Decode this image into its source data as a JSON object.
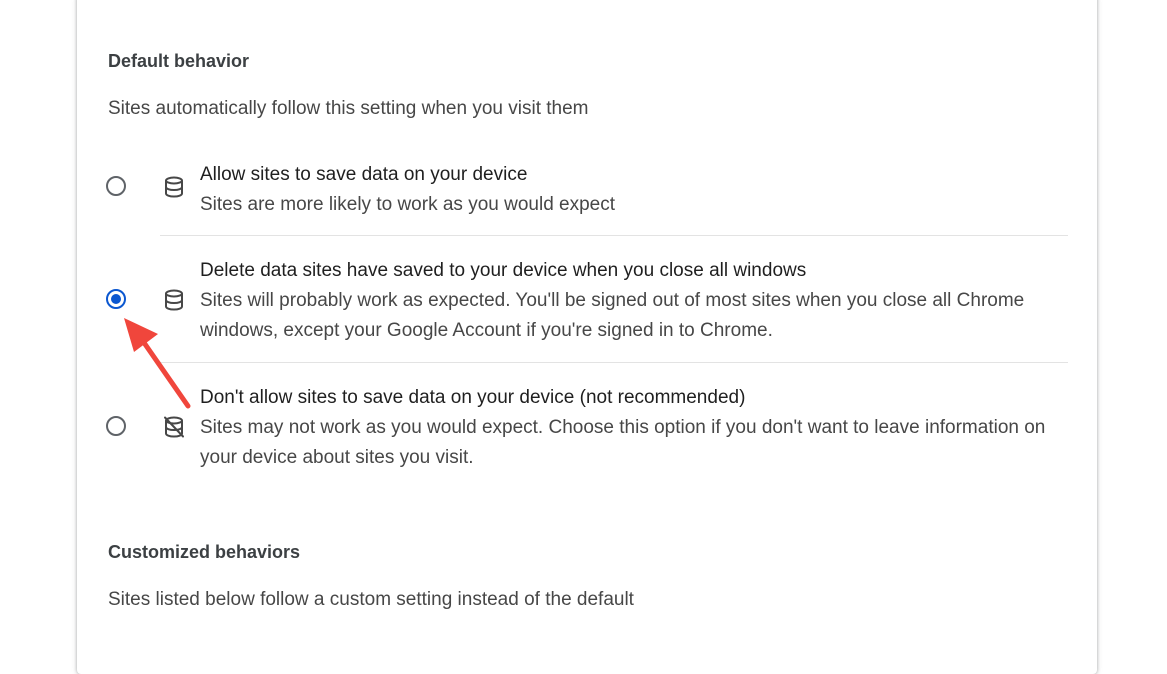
{
  "default_behavior": {
    "heading": "Default behavior",
    "description": "Sites automatically follow this setting when you visit them",
    "options": [
      {
        "label": "Allow sites to save data on your device",
        "sublabel": "Sites are more likely to work as you would expect",
        "icon": "database-icon",
        "checked": false
      },
      {
        "label": "Delete data sites have saved to your device when you close all windows",
        "sublabel": "Sites will probably work as expected. You'll be signed out of most sites when you close all Chrome windows, except your Google Account if you're signed in to Chrome.",
        "icon": "database-icon",
        "checked": true
      },
      {
        "label": "Don't allow sites to save data on your device (not recommended)",
        "sublabel": "Sites may not work as you would expect. Choose this option if you don't want to leave information on your device about sites you visit.",
        "icon": "database-off-icon",
        "checked": false
      }
    ]
  },
  "customized_behaviors": {
    "heading": "Customized behaviors",
    "description": "Sites listed below follow a custom setting instead of the default"
  },
  "colors": {
    "accent": "#0b57d0",
    "annotation_arrow": "#f0463c"
  }
}
